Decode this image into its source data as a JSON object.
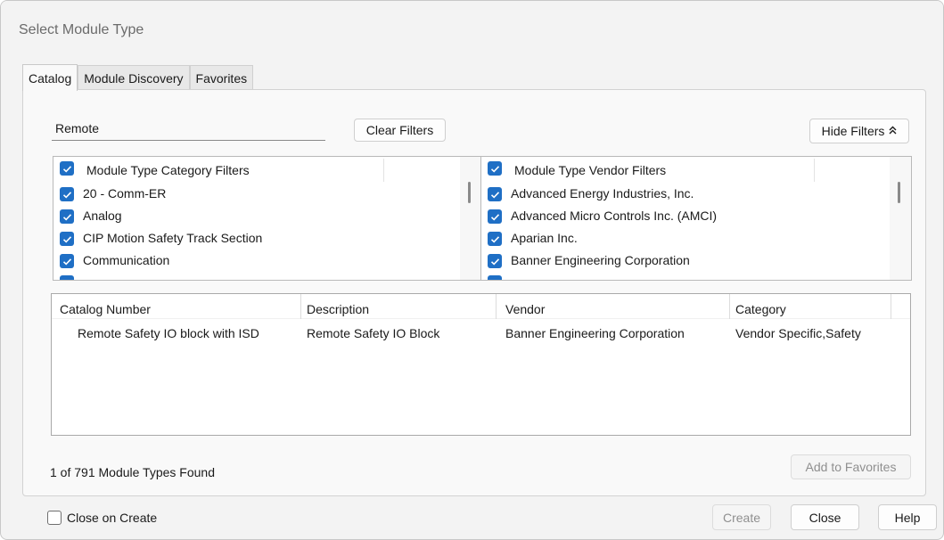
{
  "window": {
    "title": "Select Module Type"
  },
  "tabs": [
    {
      "label": "Catalog",
      "active": true
    },
    {
      "label": "Module Discovery",
      "active": false
    },
    {
      "label": "Favorites",
      "active": false
    }
  ],
  "search": {
    "value": "Remote",
    "placeholder": ""
  },
  "buttons": {
    "clear_filters": "Clear Filters",
    "hide_filters": "Hide Filters",
    "add_to_favorites": "Add to Favorites",
    "create": "Create",
    "close": "Close",
    "help": "Help"
  },
  "category_filters": {
    "header": "Module Type Category Filters",
    "items": [
      {
        "label": "20 - Comm-ER",
        "checked": true
      },
      {
        "label": "Analog",
        "checked": true
      },
      {
        "label": "CIP Motion Safety Track Section",
        "checked": true
      },
      {
        "label": "Communication",
        "checked": true
      }
    ]
  },
  "vendor_filters": {
    "header": "Module Type Vendor Filters",
    "items": [
      {
        "label": "Advanced Energy Industries, Inc.",
        "checked": true
      },
      {
        "label": "Advanced Micro Controls Inc. (AMCI)",
        "checked": true
      },
      {
        "label": "Aparian Inc.",
        "checked": true
      },
      {
        "label": "Banner Engineering Corporation",
        "checked": true
      }
    ]
  },
  "results": {
    "columns": [
      "Catalog Number",
      "Description",
      "Vendor",
      "Category"
    ],
    "rows": [
      {
        "catalog_number": "Remote Safety IO block with ISD",
        "description": "Remote Safety IO Block",
        "vendor": "Banner Engineering Corporation",
        "category": "Vendor Specific,Safety"
      }
    ]
  },
  "status": {
    "found_text": "1 of 791 Module Types Found"
  },
  "options": {
    "close_on_create": {
      "label": "Close on Create",
      "checked": false
    }
  },
  "colors": {
    "checkbox_accent": "#1f6fc5",
    "disabled_text": "#8f8f8f"
  }
}
